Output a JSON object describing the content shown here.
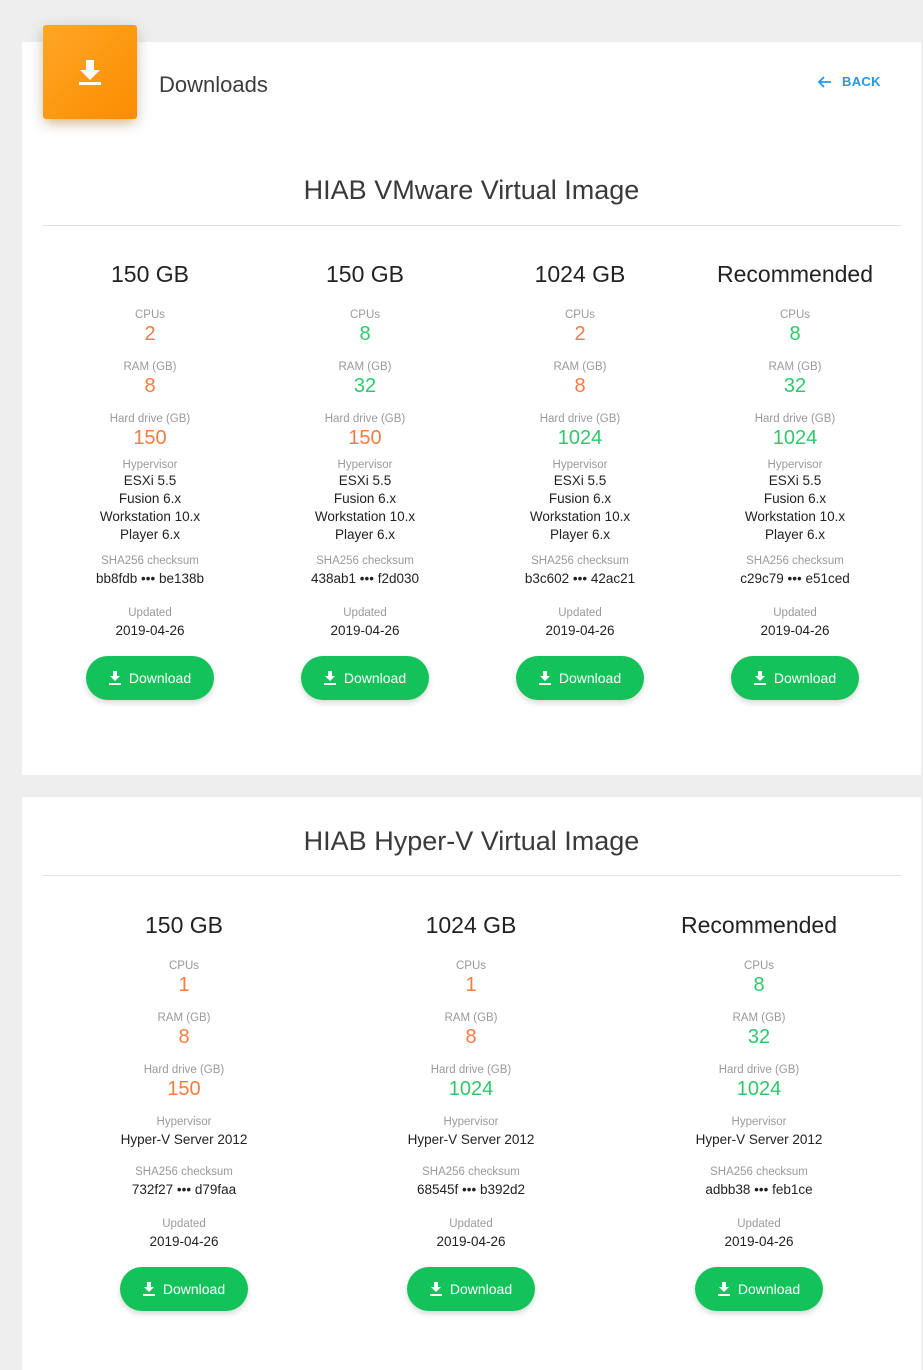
{
  "header": {
    "title": "Downloads",
    "back_label": "BACK"
  },
  "vmware": {
    "title": "HIAB VMware Virtual Image",
    "columns": [
      {
        "title": "150 GB",
        "cpus_label": "CPUs",
        "cpus": "2",
        "cpus_color": "orange",
        "ram_label": "RAM (GB)",
        "ram": "8",
        "ram_color": "orange",
        "hd_label": "Hard drive (GB)",
        "hd": "150",
        "hd_color": "orange",
        "hypervisor_label": "Hypervisor",
        "hypervisors": [
          "ESXi 5.5",
          "Fusion 6.x",
          "Workstation 10.x",
          "Player 6.x"
        ],
        "sha_label": "SHA256 checksum",
        "sha": "bb8fdb ••• be138b",
        "updated_label": "Updated",
        "updated": "2019-04-26",
        "button": "Download"
      },
      {
        "title": "150 GB",
        "cpus_label": "CPUs",
        "cpus": "8",
        "cpus_color": "green",
        "ram_label": "RAM (GB)",
        "ram": "32",
        "ram_color": "green",
        "hd_label": "Hard drive (GB)",
        "hd": "150",
        "hd_color": "orange",
        "hypervisor_label": "Hypervisor",
        "hypervisors": [
          "ESXi 5.5",
          "Fusion 6.x",
          "Workstation 10.x",
          "Player 6.x"
        ],
        "sha_label": "SHA256 checksum",
        "sha": "438ab1 ••• f2d030",
        "updated_label": "Updated",
        "updated": "2019-04-26",
        "button": "Download"
      },
      {
        "title": "1024 GB",
        "cpus_label": "CPUs",
        "cpus": "2",
        "cpus_color": "orange",
        "ram_label": "RAM (GB)",
        "ram": "8",
        "ram_color": "orange",
        "hd_label": "Hard drive (GB)",
        "hd": "1024",
        "hd_color": "green",
        "hypervisor_label": "Hypervisor",
        "hypervisors": [
          "ESXi 5.5",
          "Fusion 6.x",
          "Workstation 10.x",
          "Player 6.x"
        ],
        "sha_label": "SHA256 checksum",
        "sha": "b3c602 ••• 42ac21",
        "updated_label": "Updated",
        "updated": "2019-04-26",
        "button": "Download"
      },
      {
        "title": "Recommended",
        "cpus_label": "CPUs",
        "cpus": "8",
        "cpus_color": "green",
        "ram_label": "RAM (GB)",
        "ram": "32",
        "ram_color": "green",
        "hd_label": "Hard drive (GB)",
        "hd": "1024",
        "hd_color": "green",
        "hypervisor_label": "Hypervisor",
        "hypervisors": [
          "ESXi 5.5",
          "Fusion 6.x",
          "Workstation 10.x",
          "Player 6.x"
        ],
        "sha_label": "SHA256 checksum",
        "sha": "c29c79 ••• e51ced",
        "updated_label": "Updated",
        "updated": "2019-04-26",
        "button": "Download"
      }
    ]
  },
  "hyperv": {
    "title": "HIAB Hyper-V Virtual Image",
    "columns": [
      {
        "title": "150 GB",
        "cpus_label": "CPUs",
        "cpus": "1",
        "cpus_color": "orange",
        "ram_label": "RAM (GB)",
        "ram": "8",
        "ram_color": "orange",
        "hd_label": "Hard drive (GB)",
        "hd": "150",
        "hd_color": "orange",
        "hypervisor_label": "Hypervisor",
        "hypervisors": [
          "Hyper-V Server 2012"
        ],
        "sha_label": "SHA256 checksum",
        "sha": "732f27 ••• d79faa",
        "updated_label": "Updated",
        "updated": "2019-04-26",
        "button": "Download"
      },
      {
        "title": "1024 GB",
        "cpus_label": "CPUs",
        "cpus": "1",
        "cpus_color": "orange",
        "ram_label": "RAM (GB)",
        "ram": "8",
        "ram_color": "orange",
        "hd_label": "Hard drive (GB)",
        "hd": "1024",
        "hd_color": "green",
        "hypervisor_label": "Hypervisor",
        "hypervisors": [
          "Hyper-V Server 2012"
        ],
        "sha_label": "SHA256 checksum",
        "sha": "68545f ••• b392d2",
        "updated_label": "Updated",
        "updated": "2019-04-26",
        "button": "Download"
      },
      {
        "title": "Recommended",
        "cpus_label": "CPUs",
        "cpus": "8",
        "cpus_color": "green",
        "ram_label": "RAM (GB)",
        "ram": "32",
        "ram_color": "green",
        "hd_label": "Hard drive (GB)",
        "hd": "1024",
        "hd_color": "green",
        "hypervisor_label": "Hypervisor",
        "hypervisors": [
          "Hyper-V Server 2012"
        ],
        "sha_label": "SHA256 checksum",
        "sha": "adbb38 ••• feb1ce",
        "updated_label": "Updated",
        "updated": "2019-04-26",
        "button": "Download"
      }
    ]
  },
  "colors": {
    "orange": "#f57c42",
    "green": "#2fc96a",
    "button": "#13c35a",
    "accent": "#1e9bf0",
    "header_icon": "#fb8c00"
  }
}
